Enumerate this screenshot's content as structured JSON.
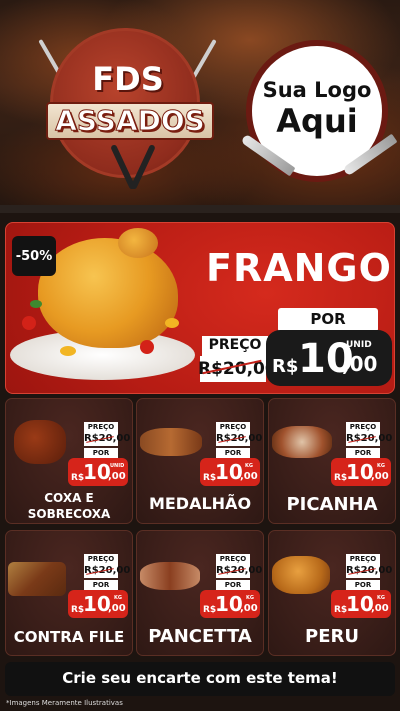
{
  "header": {
    "badge_line1": "FDS",
    "badge_line2": "ASSADOS",
    "logo_line1": "Sua Logo",
    "logo_line2": "Aqui"
  },
  "feature": {
    "discount": "-50%",
    "name": "FRANGO",
    "old_label": "PREÇO",
    "old_price": "R$20,00",
    "por_label": "POR",
    "currency": "R$",
    "new_price_int": "10",
    "new_price_dec": ",00",
    "unit": "UNID"
  },
  "products": [
    {
      "name": "COXA E SOBRECOXA",
      "old_label": "PREÇO",
      "old_price": "R$20,00",
      "por_label": "POR",
      "currency": "R$",
      "price_int": "10",
      "price_dec": ",00",
      "unit": "UNID"
    },
    {
      "name": "MEDALHÃO",
      "old_label": "PREÇO",
      "old_price": "R$20,00",
      "por_label": "POR",
      "currency": "R$",
      "price_int": "10",
      "price_dec": ",00",
      "unit": "KG"
    },
    {
      "name": "PICANHA",
      "old_label": "PREÇO",
      "old_price": "R$20,00",
      "por_label": "POR",
      "currency": "R$",
      "price_int": "10",
      "price_dec": ",00",
      "unit": "KG"
    },
    {
      "name": "CONTRA FILE",
      "old_label": "PREÇO",
      "old_price": "R$20,00",
      "por_label": "POR",
      "currency": "R$",
      "price_int": "10",
      "price_dec": ",00",
      "unit": "KG"
    },
    {
      "name": "PANCETTA",
      "old_label": "PREÇO",
      "old_price": "R$20,00",
      "por_label": "POR",
      "currency": "R$",
      "price_int": "10",
      "price_dec": ",00",
      "unit": "KG"
    },
    {
      "name": "PERU",
      "old_label": "PREÇO",
      "old_price": "R$20,00",
      "por_label": "POR",
      "currency": "R$",
      "price_int": "10",
      "price_dec": ",00",
      "unit": "KG"
    }
  ],
  "cta": "Crie seu encarte com este tema!",
  "disclaimer": "*Imagens Meramente Ilustrativas",
  "colors": {
    "primary_red": "#d6241a",
    "dark": "#111111",
    "brown": "#3a1e19"
  }
}
